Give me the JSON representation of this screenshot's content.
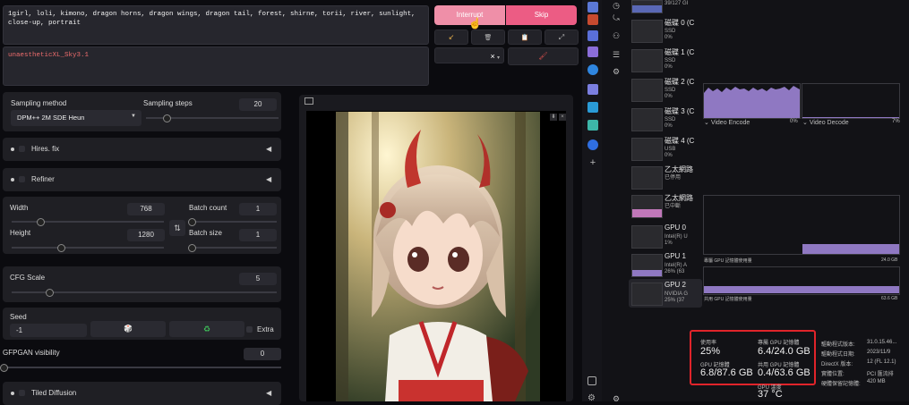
{
  "prompt": {
    "positive": "1girl, loli, kimono, dragon horns, dragon wings, dragon tail, forest, shirne, torii, river, sunlight, close-up, portrait",
    "negative": "unaestheticXL_Sky3.1"
  },
  "actions": {
    "interrupt_label": "Interrupt",
    "skip_label": "Skip"
  },
  "tools": {
    "arrow_icon": "↙",
    "trash_icon": "🗑",
    "clipboard_icon": "📋",
    "wand_icon": "⤢",
    "close_icon": "×",
    "brush_icon": "🖌"
  },
  "sampling": {
    "method_label": "Sampling method",
    "method_value": "DPM++ 2M SDE Heun",
    "steps_label": "Sampling steps",
    "steps_value": "20",
    "steps_fraction": 0.15
  },
  "sections": {
    "hires": "Hires. fix",
    "refiner": "Refiner",
    "tiled": "Tiled Diffusion"
  },
  "size": {
    "width_label": "Width",
    "width_value": "768",
    "width_fraction": 0.18,
    "height_label": "Height",
    "height_value": "1280",
    "height_fraction": 0.32,
    "swap_icon": "⇅",
    "batch_count_label": "Batch count",
    "batch_count_value": "1",
    "batch_size_label": "Batch size",
    "batch_size_value": "1"
  },
  "cfg": {
    "label": "CFG Scale",
    "value": "5",
    "fraction": 0.14
  },
  "seed": {
    "label": "Seed",
    "value": "-1",
    "dice_icon": "🎲",
    "recycle_icon": "♻",
    "extra_label": "Extra"
  },
  "gfpgan": {
    "label": "GFPGAN visibility",
    "value": "0"
  },
  "taskmgr": {
    "top_value": "39/127 GI",
    "disks": [
      {
        "name": "磁碟 0 (C",
        "type": "SSD",
        "pct": "0%"
      },
      {
        "name": "磁碟 1 (C",
        "type": "SSD",
        "pct": "0%"
      },
      {
        "name": "磁碟 2 (C",
        "type": "SSD",
        "pct": "0%"
      },
      {
        "name": "磁碟 3 (C",
        "type": "SSD",
        "pct": "0%"
      },
      {
        "name": "磁碟 4 (C",
        "type": "USB",
        "pct": "0%"
      }
    ],
    "eth1": {
      "name": "乙太網路",
      "sub": "已停用"
    },
    "eth2": {
      "name": "乙太網路",
      "sub": "已中斷"
    },
    "gpu0": {
      "name": "GPU 0",
      "sub": "Intel(R) U",
      "pct": "1%"
    },
    "gpu1": {
      "name": "GPU 1",
      "sub": "Intel(R) A",
      "pct": "26% (63"
    },
    "gpu2": {
      "name": "GPU 2",
      "sub": "NVIDIA G",
      "pct": "25% (37"
    },
    "video_encode": "Video Encode",
    "video_decode": "Video Decode",
    "video_encode_pct": "0%",
    "video_decode_pct": "7%",
    "dedicated_label": "專屬 GPU 記憶體使用量",
    "dedicated_max": "24.0 GB",
    "shared_label": "共用 GPU 記憶體使用量",
    "shared_max": "63.6 GB",
    "stats": {
      "util_label": "使用率",
      "util_value": "25%",
      "ded_label": "專屬 GPU 記憶體",
      "ded_value": "6.4/24.0 GB",
      "gpumem_label": "GPU 記憶體",
      "gpumem_value": "6.8/87.6 GB",
      "shared_label": "共用 GPU 記憶體",
      "shared_value": "0.4/63.6 GB",
      "temp_label": "GPU 溫度",
      "temp_value": "37 °C"
    },
    "details": [
      {
        "k": "驅動程式版本:",
        "v": "31.0.15.46..."
      },
      {
        "k": "驅動程式日期:",
        "v": "2023/11/9"
      },
      {
        "k": "DirectX 版本:",
        "v": "12 (FL 12.1)"
      },
      {
        "k": "實體位置:",
        "v": "PCI 匯流排"
      },
      {
        "k": "硬體保留記憶體:",
        "v": "420 MB"
      }
    ],
    "encode_level": 0.62,
    "decode_level": 0.02
  },
  "colors": {
    "interrupt": "#ef8fa8",
    "skip": "#ec5c84",
    "accent_red": "#e0242a",
    "graph_purple": "#8f78c2"
  }
}
